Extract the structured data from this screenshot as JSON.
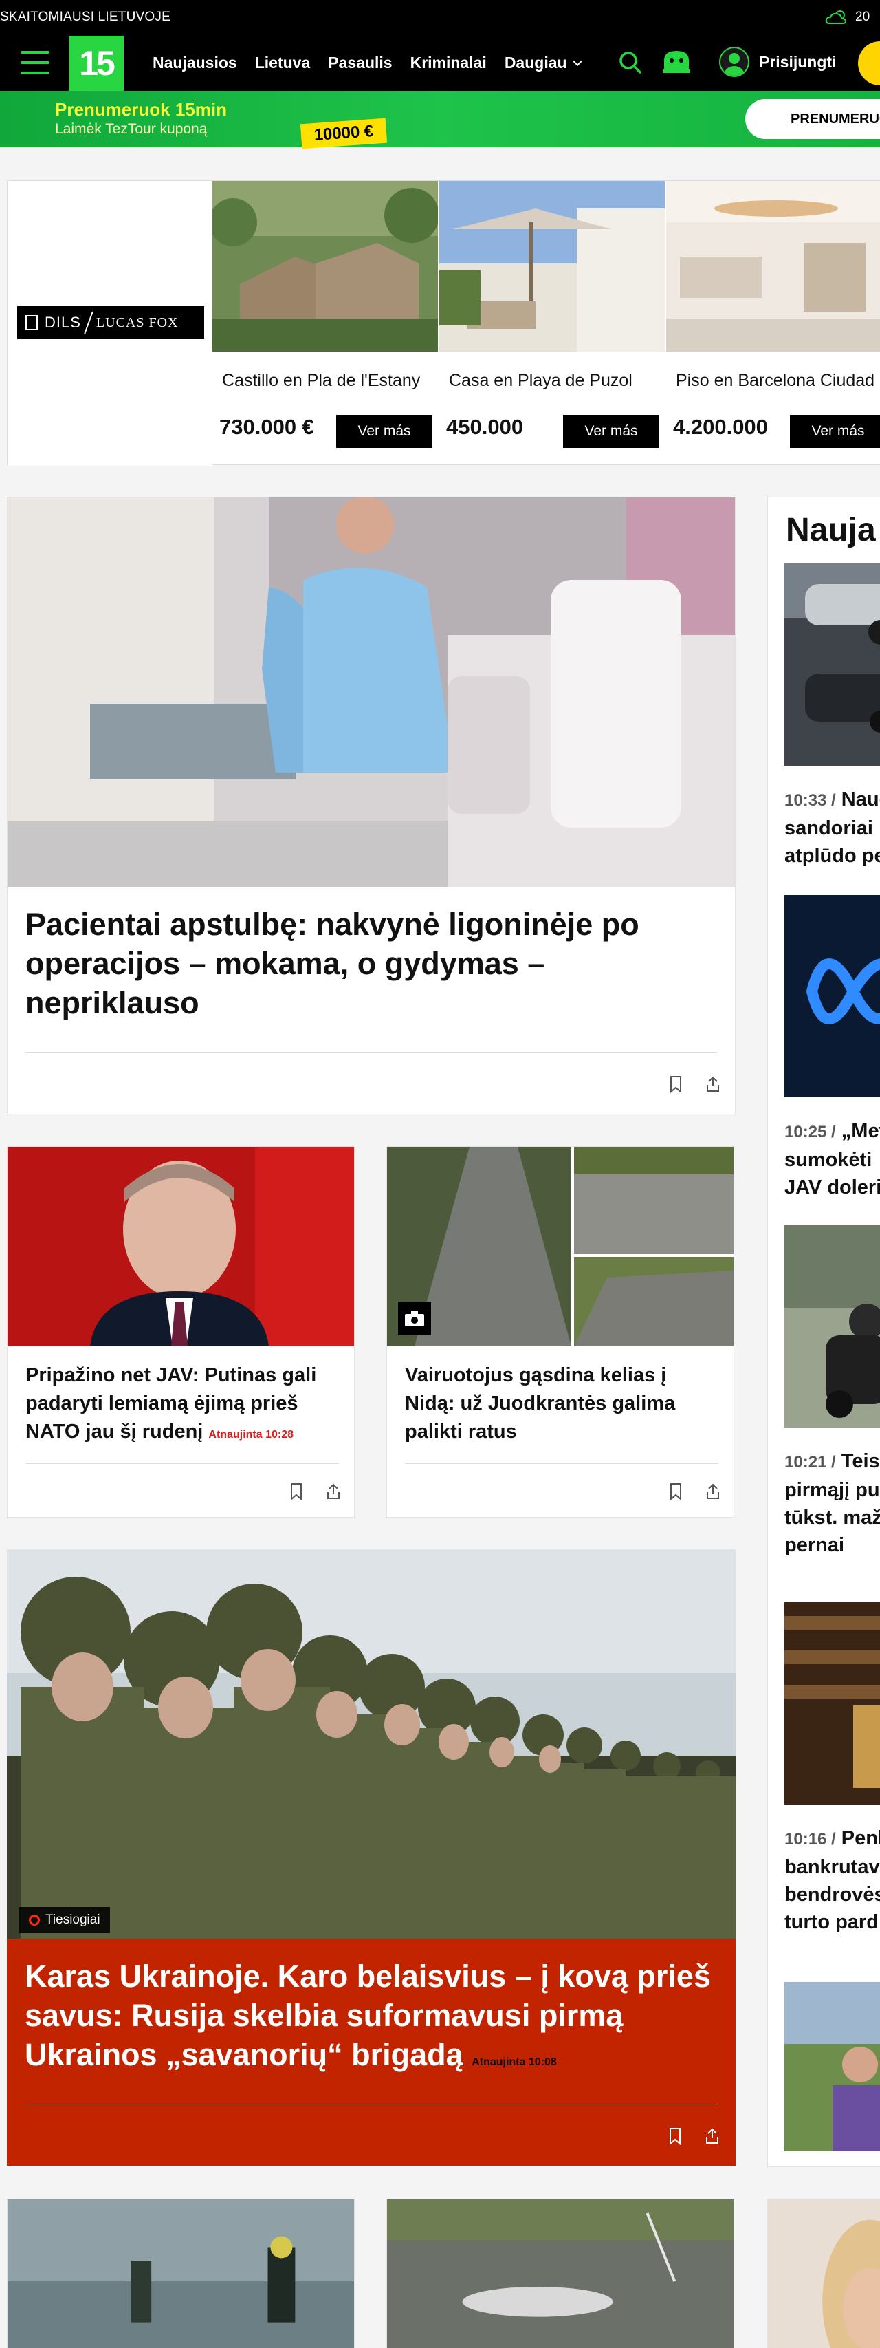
{
  "topbar": {
    "slogan": "SKAITOMIAUSI LIETUVOJE",
    "temp": "20"
  },
  "nav": {
    "logo": "15",
    "links": [
      "Naujausios",
      "Lietuva",
      "Pasaulis",
      "Kriminalai",
      "Daugiau"
    ],
    "login": "Prisijungti"
  },
  "promo": {
    "line1": "Prenumeruok 15min",
    "line2": "Laimėk TezTour kuponą",
    "coupon": "10000 €",
    "button": "PRENUMERUO"
  },
  "ad": {
    "brand_left": "DILS",
    "brand_right": "LUCAS FOX",
    "properties": [
      {
        "title": "Castillo en Pla de l'Estany",
        "price": "730.000 €",
        "button": "Ver más"
      },
      {
        "title": "Casa en Playa de Puzol",
        "price": "450.000",
        "button": "Ver más"
      },
      {
        "title": "Piso en Barcelona Ciudad",
        "price": "4.200.000",
        "button": "Ver más"
      }
    ]
  },
  "articles": {
    "hero1": {
      "headline": "Pacientai apstulbę: nakvynė ligoninėje po operacijos – mokama, o gydymas – nepriklauso"
    },
    "putin": {
      "headline": "Pripažino net JAV: Putinas gali padaryti lemiamą ėjimą prieš NATO jau šį rudenį",
      "updated": "Atnaujinta 10:28"
    },
    "road": {
      "headline": "Vairuotojus gąsdina kelias į Nidą: už Juodkrantės galima palikti ratus"
    },
    "war": {
      "live": "Tiesiogiai",
      "headline": "Karas Ukrainoje. Karo belaisvius – į kovą prieš savus: Rusija skelbia suformavusi pirmą Ukrainos „savanorių“ brigadą",
      "updated": "Atnaujinta 10:08"
    }
  },
  "sidebar": {
    "title": "Nauja",
    "items": [
      {
        "time": "10:33 /",
        "l1": "Nauc",
        "l2": "sandoriai",
        "l3": "atplūdo pe"
      },
      {
        "time": "10:25 /",
        "l1": "„Met",
        "l2": "sumokėti",
        "l3": "JAV doleri"
      },
      {
        "time": "10:21 /",
        "l1": "Teisi",
        "l2": "pirmąjį pu",
        "l3": "tūkst. maž",
        "l4": "pernai"
      },
      {
        "time": "10:16 /",
        "l1": "Penk",
        "l2": "bankrutav",
        "l3": "bendrovės",
        "l4": "turto pard"
      }
    ]
  },
  "colors": {
    "brand_green": "#27d640",
    "live_red": "#c22400",
    "accent_yellow": "#ffd400"
  }
}
